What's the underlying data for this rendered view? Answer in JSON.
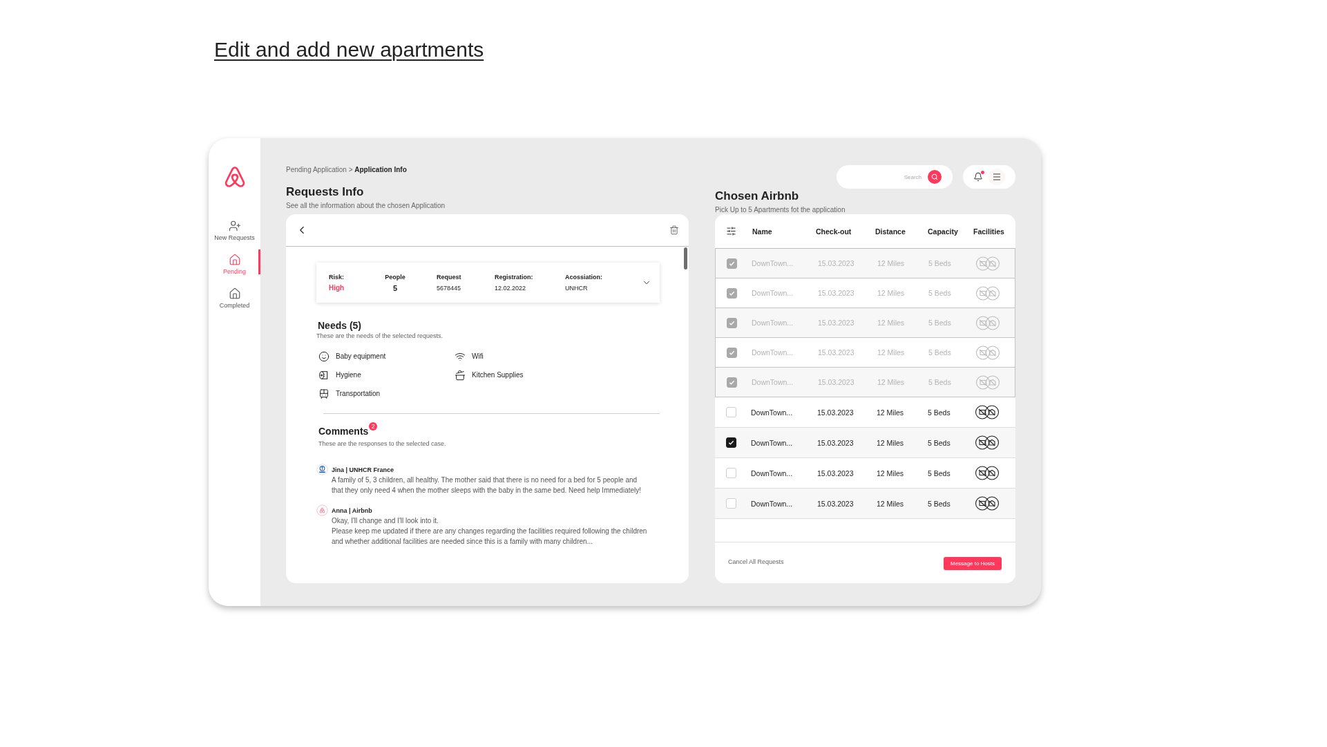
{
  "page_title": "Edit and add new apartments",
  "sidebar": {
    "items": [
      {
        "label": "New Requests",
        "selected": false
      },
      {
        "label": "Pending",
        "selected": true
      },
      {
        "label": "Completed",
        "selected": false
      }
    ]
  },
  "breadcrumb": {
    "parent": "Pending Application",
    "separator": ">",
    "current": "Application Info"
  },
  "requests_info": {
    "title": "Requests Info",
    "subtitle": "See all the information about the chosen Application",
    "summary": [
      {
        "label": "Risk:",
        "value": "High",
        "kind": "alert"
      },
      {
        "label": "People",
        "value": "5",
        "kind": "count"
      },
      {
        "label": "Request",
        "value": "5678445",
        "kind": "plain"
      },
      {
        "label": "Registration:",
        "value": "12.02.2022",
        "kind": "plain"
      },
      {
        "label": "Acossiation:",
        "value": "UNHCR",
        "kind": "plain"
      }
    ],
    "needs": {
      "title": "Needs (5)",
      "subtitle": "These are the needs of the selected requests.",
      "items": [
        "Baby equipment",
        "Hygiene",
        "Transportation",
        "Wifi",
        "Kitchen Supplies"
      ]
    },
    "comments": {
      "title": "Comments",
      "badge": "2",
      "subtitle": "These are the responses to the selected case.",
      "items": [
        {
          "author": "Jina | UNHCR France",
          "kind": "organization",
          "paragraphs": [
            "A family of 5, 3 children, all healthy. The mother said that there is no need for a bed for 5 people and that they only need 4 when the mother sleeps with the baby in the same bed. Need help Immediately!"
          ]
        },
        {
          "author": "Anna | Airbnb",
          "kind": "host",
          "paragraphs": [
            "Okay, I'll change and I'll look into it.",
            "Please keep me updated if there are any changes regarding the facilities required following the children and whether additional facilities are needed since this is a family with many children..."
          ]
        }
      ]
    }
  },
  "search": {
    "placeholder": "Search"
  },
  "notifications": {
    "unread": true
  },
  "chosen_airbnb": {
    "title": "Chosen Airbnb",
    "subtitle": "Pick Up to 5 Apartments fot the application",
    "columns": [
      "Name",
      "Check-out",
      "Distance",
      "Capacity",
      "Facilities"
    ],
    "rows": [
      {
        "name": "DownTown...",
        "checkout": "15.03.2023",
        "distance": "12 Miles",
        "capacity": "5 Beds",
        "checked": true,
        "disabled": true
      },
      {
        "name": "DownTown...",
        "checkout": "15.03.2023",
        "distance": "12 Miles",
        "capacity": "5 Beds",
        "checked": true,
        "disabled": true
      },
      {
        "name": "DownTown...",
        "checkout": "15.03.2023",
        "distance": "12 Miles",
        "capacity": "5 Beds",
        "checked": true,
        "disabled": true
      },
      {
        "name": "DownTown...",
        "checkout": "15.03.2023",
        "distance": "12 Miles",
        "capacity": "5 Beds",
        "checked": true,
        "disabled": true
      },
      {
        "name": "DownTown...",
        "checkout": "15.03.2023",
        "distance": "12 Miles",
        "capacity": "5 Beds",
        "checked": true,
        "disabled": true
      },
      {
        "name": "DownTown...",
        "checkout": "15.03.2023",
        "distance": "12 Miles",
        "capacity": "5 Beds",
        "checked": false,
        "disabled": false
      },
      {
        "name": "DownTown...",
        "checkout": "15.03.2023",
        "distance": "12 Miles",
        "capacity": "5 Beds",
        "checked": true,
        "disabled": false
      },
      {
        "name": "DownTown...",
        "checkout": "15.03.2023",
        "distance": "12 Miles",
        "capacity": "5 Beds",
        "checked": false,
        "disabled": false
      },
      {
        "name": "DownTown...",
        "checkout": "15.03.2023",
        "distance": "12 Miles",
        "capacity": "5 Beds",
        "checked": false,
        "disabled": false
      }
    ],
    "footer": {
      "cancel": "Cancel All Requests",
      "primary": "Message to Hosts"
    }
  }
}
